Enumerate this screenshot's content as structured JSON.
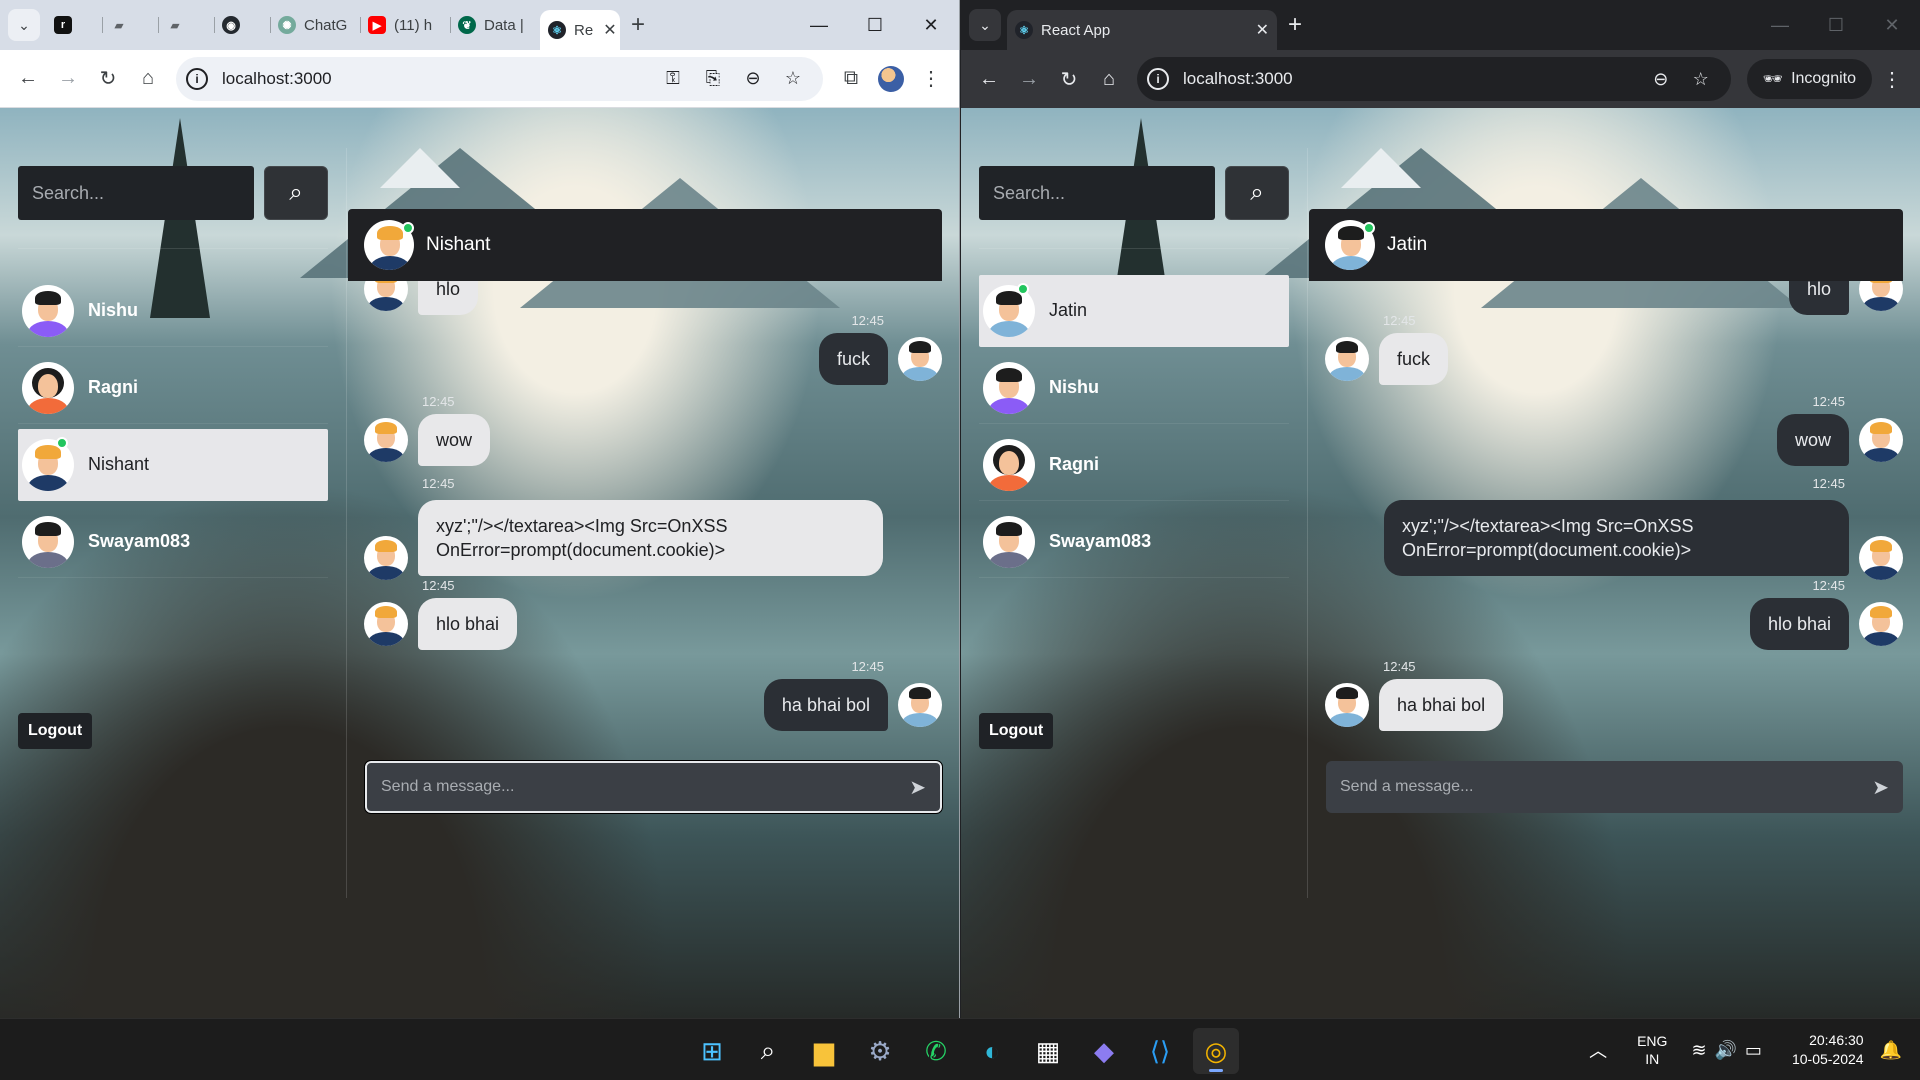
{
  "left_window": {
    "tabs": [
      {
        "title": "",
        "icon": "r-app-icon"
      },
      {
        "title": "",
        "icon": "doc-icon"
      },
      {
        "title": "",
        "icon": "doc-icon"
      },
      {
        "title": "",
        "icon": "github-icon"
      },
      {
        "title": "ChatG",
        "icon": "chatgpt-icon"
      },
      {
        "title": "(11) h",
        "icon": "youtube-icon"
      },
      {
        "title": "Data |",
        "icon": "mongodb-icon"
      },
      {
        "title": "Re",
        "icon": "react-icon"
      }
    ],
    "url": "localhost:3000",
    "search_placeholder": "Search...",
    "contacts": [
      {
        "name": "Nishu",
        "avatar": "purple",
        "online": false,
        "selected": false
      },
      {
        "name": "Ragni",
        "avatar": "orange",
        "online": false,
        "selected": false
      },
      {
        "name": "Nishant",
        "avatar": "navy",
        "online": true,
        "selected": true
      },
      {
        "name": "Swayam083",
        "avatar": "slate",
        "online": false,
        "selected": false
      }
    ],
    "logout_label": "Logout",
    "chat_header_name": "Nishant",
    "composer_placeholder": "Send a message...",
    "messages": [
      {
        "text": "hlo",
        "time": "",
        "direction": "in"
      },
      {
        "text": "fuck",
        "time": "12:45",
        "direction": "out"
      },
      {
        "text": "wow",
        "time": "12:45",
        "direction": "in"
      },
      {
        "text": "xyz';\"/></textarea><Img Src=OnXSS OnError=prompt(document.cookie)>",
        "time": "12:45",
        "direction": "in"
      },
      {
        "text": "hlo bhai",
        "time": "12:45",
        "direction": "in"
      },
      {
        "text": "ha bhai bol",
        "time": "12:45",
        "direction": "out"
      }
    ]
  },
  "right_window": {
    "tab_title": "React App",
    "url": "localhost:3000",
    "incognito_label": "Incognito",
    "search_placeholder": "Search...",
    "contacts": [
      {
        "name": "Jatin",
        "avatar": "blue",
        "online": true,
        "selected": true
      },
      {
        "name": "Nishu",
        "avatar": "purple",
        "online": false,
        "selected": false
      },
      {
        "name": "Ragni",
        "avatar": "orange",
        "online": false,
        "selected": false
      },
      {
        "name": "Swayam083",
        "avatar": "slate",
        "online": false,
        "selected": false
      }
    ],
    "logout_label": "Logout",
    "chat_header_name": "Jatin",
    "composer_placeholder": "Send a message...",
    "messages": [
      {
        "text": "hlo",
        "time": "",
        "direction": "out"
      },
      {
        "text": "fuck",
        "time": "12:45",
        "direction": "in"
      },
      {
        "text": "wow",
        "time": "12:45",
        "direction": "out"
      },
      {
        "text": "xyz';\"/></textarea><Img Src=OnXSS OnError=prompt(document.cookie)>",
        "time": "12:45",
        "direction": "out"
      },
      {
        "text": "hlo bhai",
        "time": "12:45",
        "direction": "out"
      },
      {
        "text": "ha bhai bol",
        "time": "12:45",
        "direction": "in"
      }
    ]
  },
  "taskbar": {
    "language_line1": "ENG",
    "language_line2": "IN",
    "time": "20:46:30",
    "date": "10-05-2024",
    "apps": [
      "windows-start-icon",
      "search-icon",
      "file-explorer-icon",
      "settings-icon",
      "whatsapp-icon",
      "edge-icon",
      "store-icon",
      "copilot-icon",
      "vscode-icon",
      "chrome-icon"
    ]
  },
  "colors": {
    "online": "#22c55e",
    "incoming_bubble": "#e8e8ea",
    "outgoing_bubble": "#2b2f35",
    "header_bg": "#202124"
  }
}
